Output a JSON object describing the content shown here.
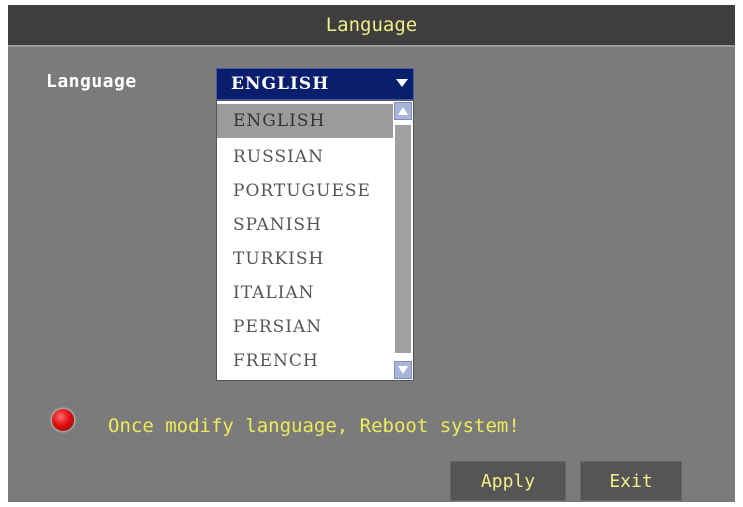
{
  "window": {
    "title": "Language"
  },
  "form": {
    "language_label": "Language",
    "language_select": {
      "selected_value": "ENGLISH",
      "options": [
        "ENGLISH",
        "RUSSIAN",
        "PORTUGUESE",
        "SPANISH",
        "TURKISH",
        "ITALIAN",
        "PERSIAN",
        "FRENCH"
      ],
      "highlighted_option": "ENGLISH"
    }
  },
  "notice": {
    "icon": "red-dot-icon",
    "text": "Once modify language, Reboot system!"
  },
  "buttons": {
    "apply_label": "Apply",
    "exit_label": "Exit"
  },
  "colors": {
    "background": "#7b7b7b",
    "titlebar": "#3e3e3e",
    "title_text": "#f0ee88",
    "notice_text": "#ecec5a",
    "select_bg": "#0a1e6e",
    "button_bg": "#555555"
  }
}
